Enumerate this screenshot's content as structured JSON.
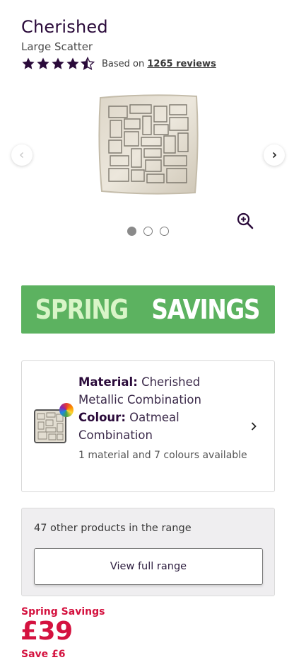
{
  "product": {
    "title": "Cherished",
    "subtitle": "Large Scatter",
    "rating": 4.5,
    "reviews_prefix": "Based on",
    "reviews_link": "1265 reviews"
  },
  "gallery": {
    "image_count": 3,
    "active_index": 0
  },
  "banner": {
    "word1": "SPRING",
    "word2": "SAVINGS",
    "background": "#5cb260"
  },
  "variant": {
    "material_label": "Material:",
    "material_value": "Cherished Metallic Combination",
    "colour_label": "Colour:",
    "colour_value": "Oatmeal Combination",
    "note": "1 material and 7 colours available"
  },
  "range": {
    "text": "47 other products in the range",
    "button_label": "View full range"
  },
  "pricing": {
    "promo_label": "Spring Savings",
    "price": "£39",
    "save": "Save £6",
    "accent": "#d4123f"
  },
  "icons": {
    "prev": "chevron-left-icon",
    "next": "chevron-right-icon",
    "zoom": "zoom-in-icon",
    "star": "star-icon",
    "variant_chevron": "chevron-right-icon"
  }
}
